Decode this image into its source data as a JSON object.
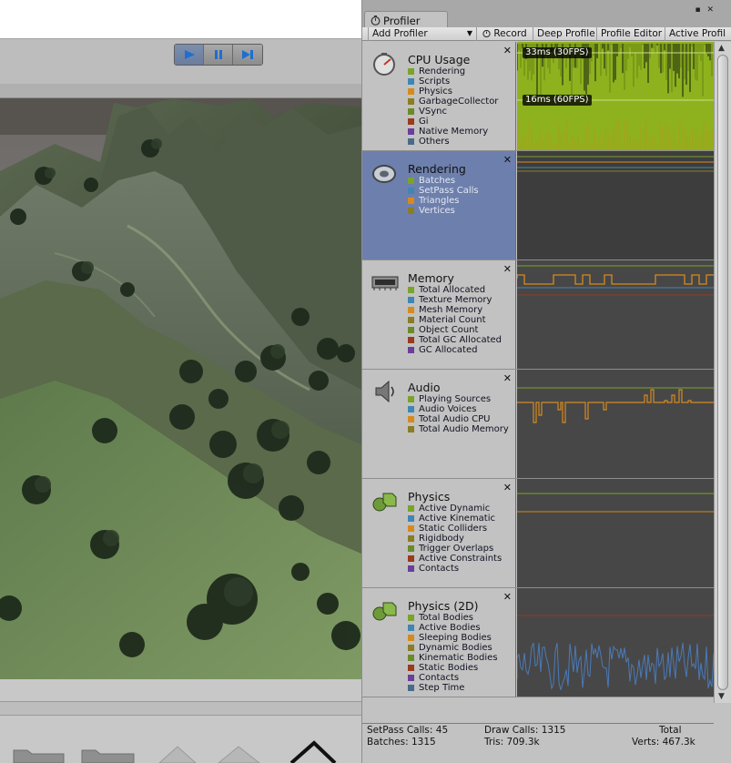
{
  "playbar": {
    "play_icon": "play-icon",
    "pause_icon": "pause-icon",
    "step_icon": "step-icon",
    "play_active": true
  },
  "profiler": {
    "tab_title": "Profiler",
    "toolbar": {
      "add_profiler": "Add Profiler",
      "record": "Record",
      "deep_profile": "Deep Profile",
      "profile_editor": "Profile Editor",
      "active_profiler": "Active Profil"
    },
    "areas": [
      {
        "title": "CPU Usage",
        "icon": "cpu-usage-icon",
        "items": [
          {
            "label": "Rendering",
            "color": "#7aa32a"
          },
          {
            "label": "Scripts",
            "color": "#3f86b4"
          },
          {
            "label": "Physics",
            "color": "#d68a1e"
          },
          {
            "label": "GarbageCollector",
            "color": "#8a7d24"
          },
          {
            "label": "VSync",
            "color": "#6b8a2a"
          },
          {
            "label": "Gi",
            "color": "#9a3a1e"
          },
          {
            "label": "Native Memory",
            "color": "#6a3f9a"
          },
          {
            "label": "Others",
            "color": "#4a6a8a"
          }
        ],
        "fps_labels": [
          "33ms (30FPS)",
          "16ms (60FPS)"
        ]
      },
      {
        "title": "Rendering",
        "icon": "rendering-icon",
        "selected": true,
        "items": [
          {
            "label": "Batches",
            "color": "#7aa32a"
          },
          {
            "label": "SetPass Calls",
            "color": "#3f86b4"
          },
          {
            "label": "Triangles",
            "color": "#d68a1e"
          },
          {
            "label": "Vertices",
            "color": "#8a7d24"
          }
        ]
      },
      {
        "title": "Memory",
        "icon": "memory-icon",
        "items": [
          {
            "label": "Total Allocated",
            "color": "#7aa32a"
          },
          {
            "label": "Texture Memory",
            "color": "#3f86b4"
          },
          {
            "label": "Mesh Memory",
            "color": "#d68a1e"
          },
          {
            "label": "Material Count",
            "color": "#8a7d24"
          },
          {
            "label": "Object Count",
            "color": "#6b8a2a"
          },
          {
            "label": "Total GC Allocated",
            "color": "#9a3a1e"
          },
          {
            "label": "GC Allocated",
            "color": "#6a3f9a"
          }
        ]
      },
      {
        "title": "Audio",
        "icon": "audio-icon",
        "items": [
          {
            "label": "Playing Sources",
            "color": "#7aa32a"
          },
          {
            "label": "Audio Voices",
            "color": "#3f86b4"
          },
          {
            "label": "Total Audio CPU",
            "color": "#d68a1e"
          },
          {
            "label": "Total Audio Memory",
            "color": "#8a7d24"
          }
        ]
      },
      {
        "title": "Physics",
        "icon": "physics-icon",
        "items": [
          {
            "label": "Active Dynamic",
            "color": "#7aa32a"
          },
          {
            "label": "Active Kinematic",
            "color": "#3f86b4"
          },
          {
            "label": "Static Colliders",
            "color": "#d68a1e"
          },
          {
            "label": "Rigidbody",
            "color": "#8a7d24"
          },
          {
            "label": "Trigger Overlaps",
            "color": "#6b8a2a"
          },
          {
            "label": "Active Constraints",
            "color": "#9a3a1e"
          },
          {
            "label": "Contacts",
            "color": "#6a3f9a"
          }
        ]
      },
      {
        "title": "Physics (2D)",
        "icon": "physics-2d-icon",
        "items": [
          {
            "label": "Total Bodies",
            "color": "#7aa32a"
          },
          {
            "label": "Active Bodies",
            "color": "#3f86b4"
          },
          {
            "label": "Sleeping Bodies",
            "color": "#d68a1e"
          },
          {
            "label": "Dynamic Bodies",
            "color": "#8a7d24"
          },
          {
            "label": "Kinematic Bodies",
            "color": "#6b8a2a"
          },
          {
            "label": "Static Bodies",
            "color": "#9a3a1e"
          },
          {
            "label": "Contacts",
            "color": "#6a3f9a"
          },
          {
            "label": "Step Time",
            "color": "#4a6a8a"
          }
        ]
      }
    ],
    "stats": {
      "setpass": "SetPass Calls: 45",
      "draw": "Draw Calls: 1315",
      "total": "Total",
      "batches": "Batches: 1315",
      "tris": "Tris: 709.3k",
      "verts": "Verts: 467.3k"
    }
  }
}
